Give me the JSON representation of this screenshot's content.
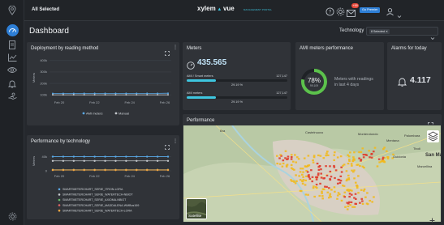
{
  "topbar": {
    "selection_label": "All Selected",
    "brand": "xylem",
    "brand_product": "vue",
    "brand_tagline": "MANAGEMENT PORTAL",
    "notification_badge": "+99",
    "go_premier_label": "Go Premier"
  },
  "page": {
    "title": "Dashboard"
  },
  "filter": {
    "technology_label": "Technology",
    "technology_chip": "8 Selected"
  },
  "deployment": {
    "title": "Deployment by reading method",
    "chart_data": {
      "type": "line",
      "title": "Deployment by reading method",
      "xlabel": "",
      "ylabel": "Meters",
      "categories": [
        "Feb 20",
        "Feb 22",
        "Feb 24",
        "Feb 26"
      ],
      "y_ticks": [
        "100k",
        "200k",
        "300k",
        "400k"
      ],
      "ylim": [
        80000,
        420000
      ],
      "legend_position": "bottom",
      "series": [
        {
          "name": "AMI meters",
          "color": "#5aa9e6",
          "values": [
            112000,
            112000,
            112000,
            113000,
            113000,
            113000,
            113000,
            113000,
            113000,
            113000,
            113000,
            114000
          ]
        },
        {
          "name": "Manual",
          "color": "#c4c8cc",
          "values": [
            100000,
            100000,
            100000,
            100000,
            100000,
            100000,
            100000,
            100000,
            100000,
            100000,
            100000,
            100000
          ]
        }
      ]
    }
  },
  "meters": {
    "title": "Meters",
    "total": "435.565",
    "rows": [
      {
        "label": "AMI / Smart meters",
        "value": "127,147",
        "percent": "29.19 %",
        "fraction": 0.2919,
        "color": "#3ec6df"
      },
      {
        "label": "AMI meters",
        "value": "127,147",
        "percent": "29.19 %",
        "fraction": 0.2919,
        "color": "#3ec6df"
      }
    ]
  },
  "ami_performance": {
    "title": "AMI meters performance",
    "percent_label": "78%",
    "fraction": 0.78,
    "sub_value": "99.109",
    "description_line1": "Meters with readings",
    "description_line2": "in last 4 days"
  },
  "alarms": {
    "title": "Alarms for today",
    "value": "4.117"
  },
  "performance_tech": {
    "title": "Performance by technology",
    "chart_data": {
      "type": "line",
      "title": "Performance by technology",
      "xlabel": "",
      "ylabel": "Meters",
      "categories": [
        "Feb 20",
        "Feb 22",
        "Feb 24",
        "Feb 26"
      ],
      "y_ticks": [
        "0",
        "40k"
      ],
      "ylim": [
        0,
        55000
      ],
      "legend_position": "bottom",
      "series": [
        {
          "name": "SMARTMETERCHART_SERIE_ITRON-LORA",
          "color": "#5aa9e6",
          "values": [
            40000,
            40000,
            40000,
            40000,
            40000,
            40000,
            40000,
            40000,
            40000,
            40000,
            40000,
            40000
          ]
        },
        {
          "name": "SMARTMETERCHART_SERIE_WATERTECH-NBIOT",
          "color": "#c4c8cc",
          "values": [
            28000,
            28000,
            28000,
            28000,
            28000,
            28000,
            28000,
            28000,
            28000,
            28000,
            28000,
            28000
          ]
        },
        {
          "name": "SMARTMETERCHART_SERIE_AXIOMA-NBIOT",
          "color": "#66bb6a",
          "values": [
            3000,
            3000,
            3000,
            3000,
            3000,
            3000,
            3000,
            3000,
            3000,
            3000,
            3000,
            3000
          ]
        },
        {
          "name": "SMARTMETERCHART_SERIE_MADDALENA-WMBus169",
          "color": "#e06666",
          "values": [
            2500,
            2500,
            2500,
            2500,
            2500,
            2500,
            2500,
            2500,
            2500,
            2500,
            2500,
            2500
          ]
        },
        {
          "name": "SMARTMETERCHART_SERIE_WATERTECH-LORA",
          "color": "#f0a742",
          "values": [
            2000,
            2000,
            2000,
            2000,
            2000,
            2000,
            2000,
            2000,
            2000,
            2000,
            2000,
            2000
          ]
        }
      ]
    }
  },
  "performance_map": {
    "title": "Performance",
    "places": [
      "Bra",
      "Castelnuovo",
      "Monterotondo",
      "Mentana",
      "Palombara",
      "Tivoli",
      "Guidonia",
      "Marcellina",
      "San Ma"
    ],
    "layer_label": "Satellite",
    "colors": {
      "land": "#b9c9a5",
      "urban": "#d8d0c4",
      "water": "#aad3df",
      "hot": "#e03b2b",
      "warm": "#f2b91d"
    }
  },
  "colors": {
    "accent": "#2e7fd6",
    "background": "#25282d",
    "panel": "#303338",
    "meters_bar": "#3ec6df",
    "ring": "#5cc24c",
    "badge": "#e5493b"
  },
  "icons": {
    "sidebar": [
      "location-pin-icon",
      "dashboard-icon",
      "document-icon",
      "graph-icon",
      "eye-icon",
      "bell-icon",
      "hand-icon",
      "settings-icon"
    ],
    "topbar": [
      "help-icon",
      "settings-icon",
      "mail-icon",
      "user-icon"
    ]
  }
}
